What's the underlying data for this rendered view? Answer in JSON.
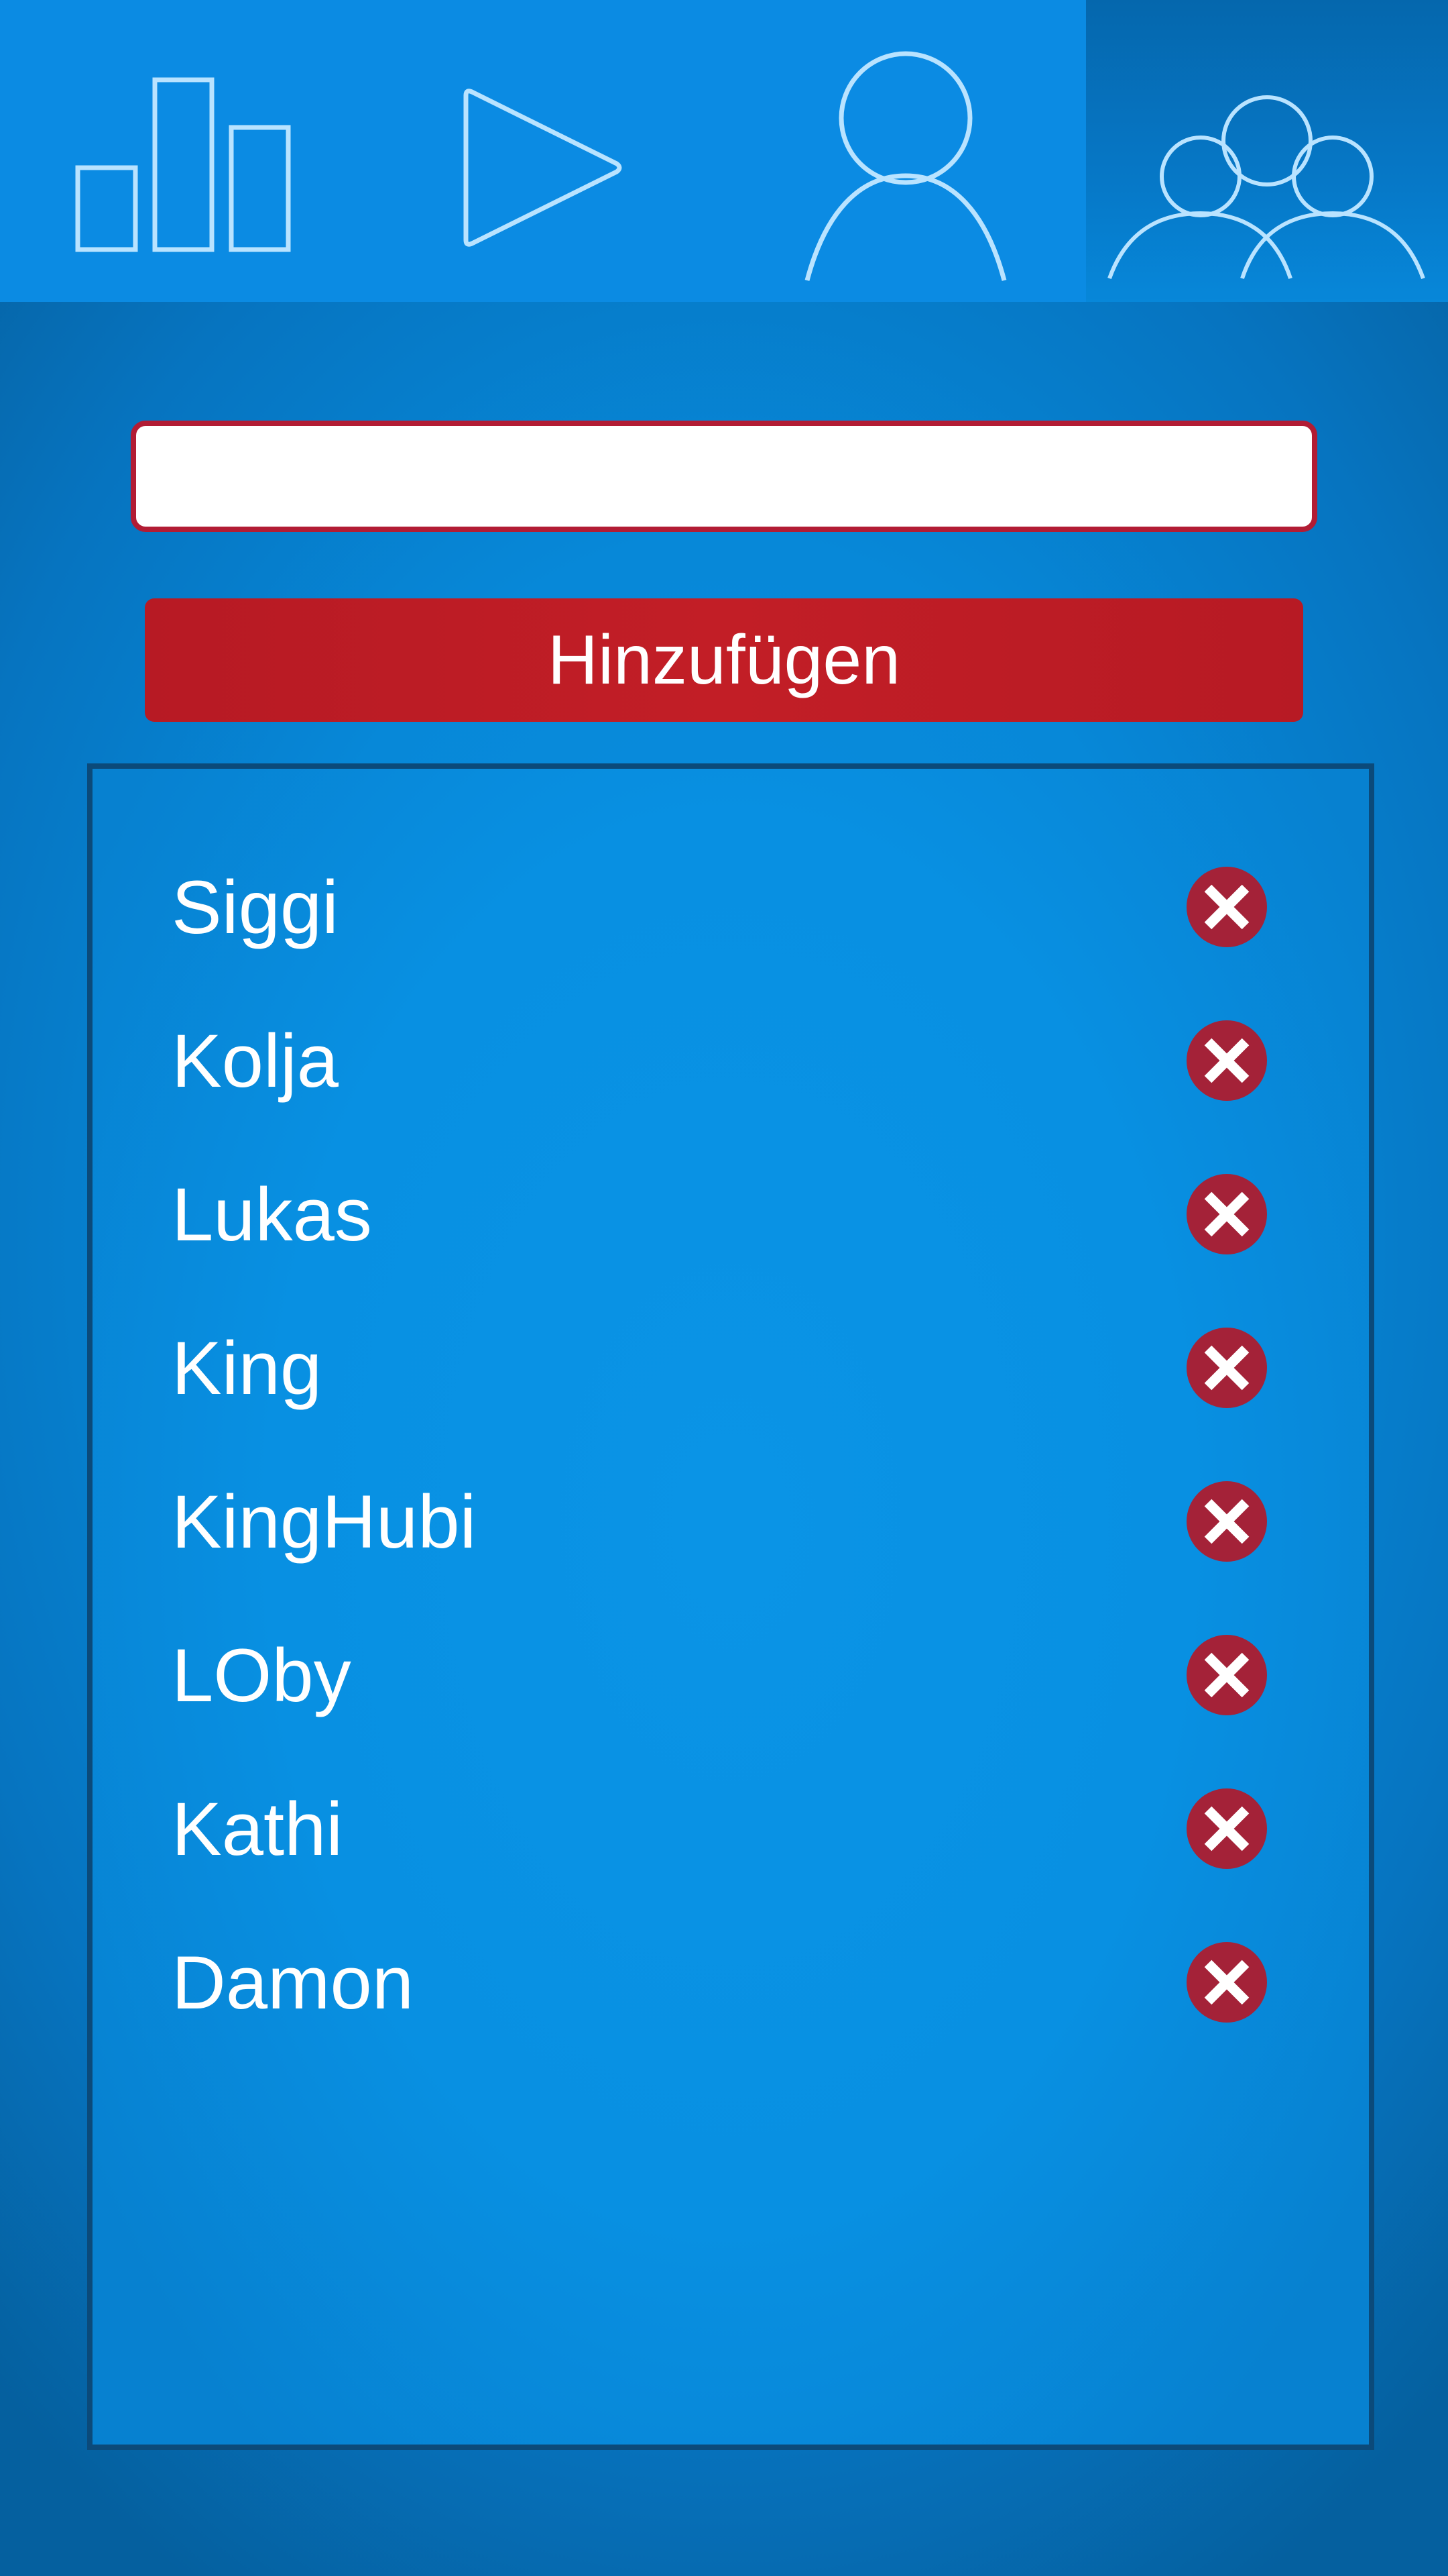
{
  "tabs": [
    {
      "id": "stats",
      "icon": "bar-chart-icon"
    },
    {
      "id": "play",
      "icon": "play-icon"
    },
    {
      "id": "profile",
      "icon": "user-icon"
    },
    {
      "id": "players",
      "icon": "group-icon",
      "selected": true
    }
  ],
  "form": {
    "input_value": "",
    "input_placeholder": "",
    "add_label": "Hinzufügen"
  },
  "players": [
    {
      "name": "Siggi"
    },
    {
      "name": "Kolja"
    },
    {
      "name": "Lukas"
    },
    {
      "name": "King"
    },
    {
      "name": "KingHubi"
    },
    {
      "name": "LOby"
    },
    {
      "name": "Kathi"
    },
    {
      "name": "Damon"
    }
  ],
  "colors": {
    "background": "#0788d8",
    "accent_red": "#c21e26",
    "remove_icon": "#a42238",
    "input_border": "#b21c34",
    "list_border": "#0b4a7a",
    "icon_stroke": "#b9e3ff"
  },
  "icons": {
    "remove": "remove-x-icon"
  }
}
